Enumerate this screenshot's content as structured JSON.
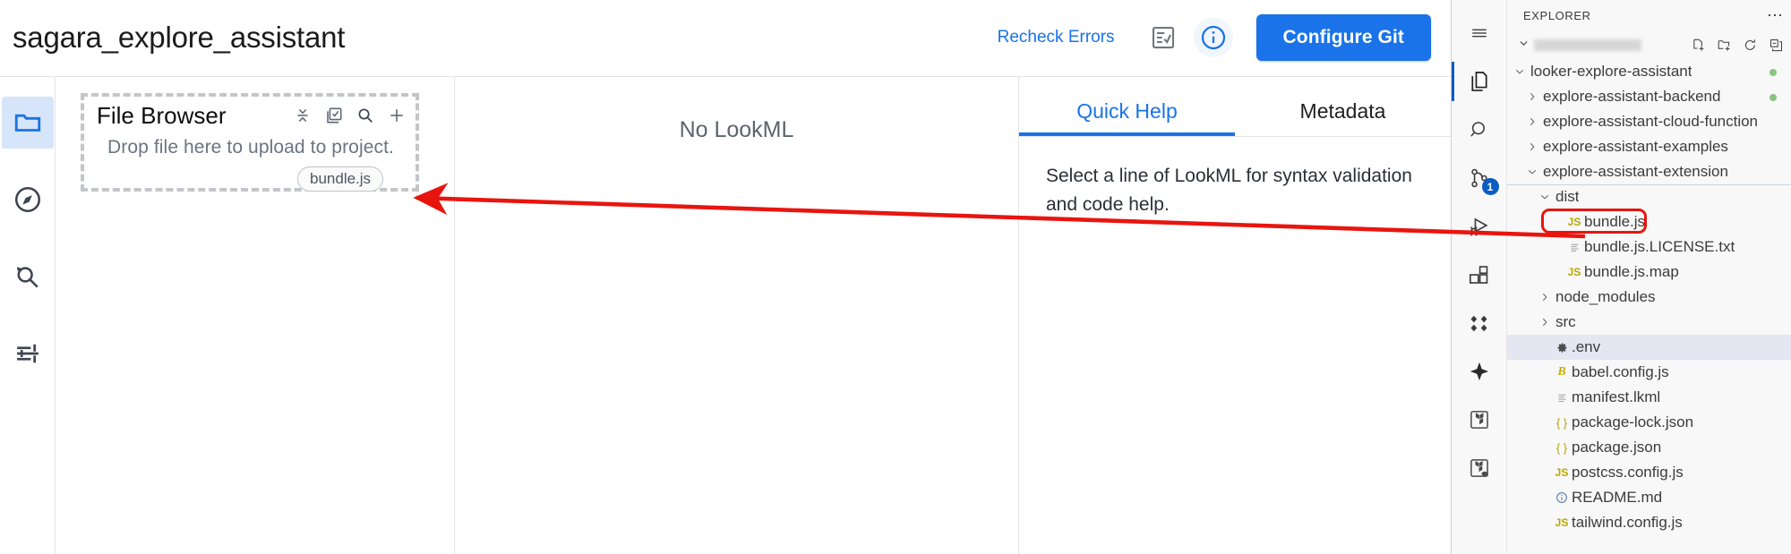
{
  "looker": {
    "project_title": "sagara_explore_assistant",
    "header": {
      "recheck_label": "Recheck Errors",
      "validate_icon": "checklist-icon",
      "info_icon": "info-circle-icon",
      "configure_git_label": "Configure Git",
      "accent_color": "#1a73e8"
    },
    "rail": [
      {
        "name": "file-browser",
        "icon": "folder-icon",
        "active": true
      },
      {
        "name": "explore",
        "icon": "compass-icon",
        "active": false
      },
      {
        "name": "search-history",
        "icon": "search-history-icon",
        "active": false
      },
      {
        "name": "settings",
        "icon": "tune-sliders-icon",
        "active": false
      }
    ],
    "file_browser": {
      "title": "File Browser",
      "dropzone_text": "Drop file here to upload to project.",
      "chip_label": "bundle.js",
      "actions": [
        {
          "name": "collapse-all",
          "icon": "collapse-icon"
        },
        {
          "name": "select-files",
          "icon": "checkbox-list-icon"
        },
        {
          "name": "search-files",
          "icon": "search-icon"
        },
        {
          "name": "add-file",
          "icon": "plus-icon"
        }
      ]
    },
    "center": {
      "empty_state": "No LookML"
    },
    "right_panel": {
      "tabs": [
        {
          "label": "Quick Help",
          "active": true
        },
        {
          "label": "Metadata",
          "active": false
        }
      ],
      "body_text": "Select a line of LookML for syntax validation and code help."
    }
  },
  "vscode": {
    "activity_bar": [
      {
        "name": "menu",
        "icon": "hamburger-menu-icon",
        "active": false,
        "badge": ""
      },
      {
        "name": "explorer",
        "icon": "files-icon",
        "active": true,
        "badge": ""
      },
      {
        "name": "search",
        "icon": "search-icon",
        "active": false,
        "badge": ""
      },
      {
        "name": "source-control",
        "icon": "source-control-branch-icon",
        "active": false,
        "badge": "1"
      },
      {
        "name": "run-and-debug",
        "icon": "run-debug-icon",
        "active": false,
        "badge": ""
      },
      {
        "name": "extensions",
        "icon": "extensions-blocks-icon",
        "active": false,
        "badge": ""
      },
      {
        "name": "test-explorer",
        "icon": "diamonds-icon",
        "active": false,
        "badge": ""
      },
      {
        "name": "gemini-code-assist",
        "icon": "sparkle-icon",
        "active": false,
        "badge": ""
      },
      {
        "name": "terraform",
        "icon": "terraform-icon",
        "active": false,
        "badge": ""
      },
      {
        "name": "terraform-cloud",
        "icon": "terraform-cloud-icon",
        "active": false,
        "badge": ""
      }
    ],
    "sidebar": {
      "title": "EXPLORER",
      "more_actions_icon": "ellipsis-icon",
      "workspace_name": "",
      "workspace_name_redacted": true,
      "workspace_tools": [
        {
          "name": "new-file",
          "icon": "new-file-icon"
        },
        {
          "name": "new-folder",
          "icon": "new-folder-icon"
        },
        {
          "name": "refresh-explorer",
          "icon": "refresh-icon"
        },
        {
          "name": "collapse-folders",
          "icon": "collapse-all-icon"
        }
      ],
      "tree": [
        {
          "label": "looker-explore-assistant",
          "kind": "folder",
          "depth": 0,
          "expanded": true,
          "git_dot": true
        },
        {
          "label": "explore-assistant-backend",
          "kind": "folder",
          "depth": 1,
          "expanded": false,
          "git_dot": true
        },
        {
          "label": "explore-assistant-cloud-function",
          "kind": "folder",
          "depth": 1,
          "expanded": false,
          "git_dot": false
        },
        {
          "label": "explore-assistant-examples",
          "kind": "folder",
          "depth": 1,
          "expanded": false,
          "git_dot": false
        },
        {
          "label": "explore-assistant-extension",
          "kind": "folder",
          "depth": 1,
          "expanded": true,
          "git_dot": false
        },
        {
          "label": "dist",
          "kind": "folder",
          "depth": 2,
          "expanded": true,
          "git_dot": false
        },
        {
          "label": "bundle.js",
          "kind": "js",
          "depth": 3,
          "highlighted": true,
          "git_dot": false
        },
        {
          "label": "bundle.js.LICENSE.txt",
          "kind": "txt",
          "depth": 3,
          "git_dot": false
        },
        {
          "label": "bundle.js.map",
          "kind": "js",
          "depth": 3,
          "git_dot": false
        },
        {
          "label": "node_modules",
          "kind": "folder",
          "depth": 2,
          "expanded": false,
          "git_dot": false
        },
        {
          "label": "src",
          "kind": "folder",
          "depth": 2,
          "expanded": false,
          "git_dot": false
        },
        {
          "label": ".env",
          "kind": "gear",
          "depth": 2,
          "selected": true,
          "git_dot": false
        },
        {
          "label": "babel.config.js",
          "kind": "babel",
          "depth": 2,
          "git_dot": false
        },
        {
          "label": "manifest.lkml",
          "kind": "txt",
          "depth": 2,
          "git_dot": false
        },
        {
          "label": "package-lock.json",
          "kind": "json",
          "depth": 2,
          "git_dot": false
        },
        {
          "label": "package.json",
          "kind": "json",
          "depth": 2,
          "git_dot": false
        },
        {
          "label": "postcss.config.js",
          "kind": "js",
          "depth": 2,
          "git_dot": false
        },
        {
          "label": "README.md",
          "kind": "info",
          "depth": 2,
          "git_dot": false
        },
        {
          "label": "tailwind.config.js",
          "kind": "js",
          "depth": 2,
          "git_dot": false
        }
      ]
    }
  },
  "annotation": {
    "arrow_color": "#e8150f",
    "from": "bundle.js in VS Code dist folder",
    "to": "bundle.js chip in Looker File Browser"
  }
}
